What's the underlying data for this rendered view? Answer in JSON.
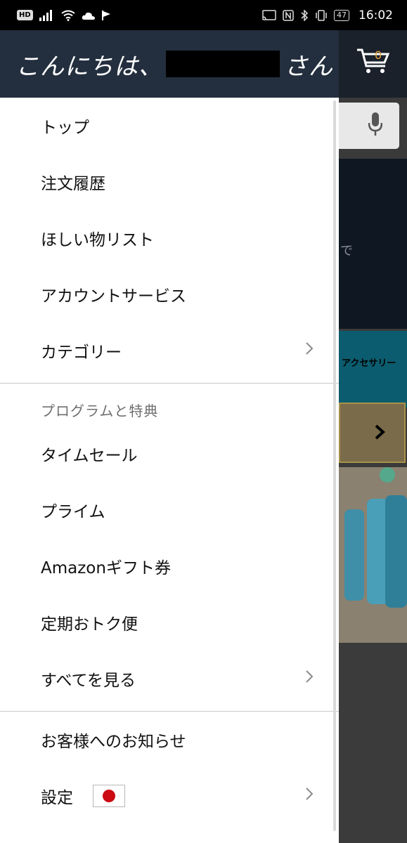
{
  "status_bar": {
    "hd": "HD",
    "battery": "47",
    "time": "16:02"
  },
  "background": {
    "cart_count": "0",
    "partial_text_de": "で",
    "partial_text_accessory": "アクセサリー"
  },
  "drawer": {
    "greeting_prefix": "こんにちは、",
    "greeting_suffix": "さん",
    "items_top": [
      {
        "label": "トップ"
      },
      {
        "label": "注文履歴"
      },
      {
        "label": "ほしい物リスト"
      },
      {
        "label": "アカウントサービス"
      },
      {
        "label": "カテゴリー",
        "chevron": true
      }
    ],
    "section_label": "プログラムと特典",
    "items_program": [
      {
        "label": "タイムセール"
      },
      {
        "label": "プライム"
      },
      {
        "label": "Amazonギフト券"
      },
      {
        "label": "定期おトク便"
      },
      {
        "label": "すべてを見る",
        "chevron": true
      }
    ],
    "items_bottom": [
      {
        "label": "お客様へのお知らせ"
      },
      {
        "label": "設定",
        "chevron": true
      }
    ]
  },
  "colors": {
    "header_bg": "#232f3e",
    "accent_orange": "#e7a13c",
    "flag_red": "#cc0b12"
  }
}
